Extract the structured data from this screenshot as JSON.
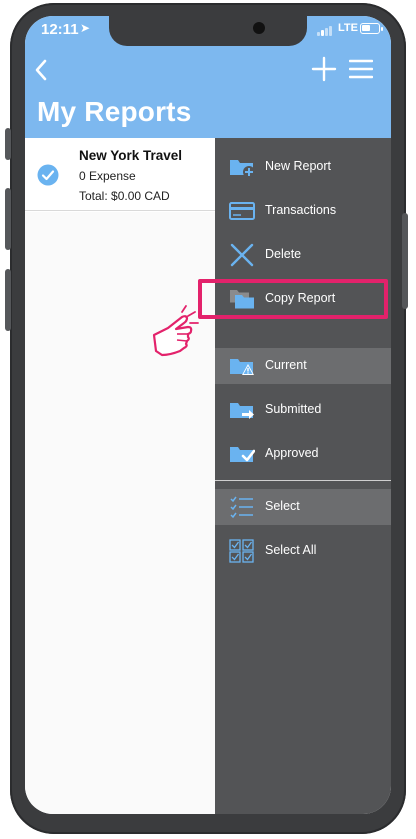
{
  "status_bar": {
    "time": "12:11",
    "network": "LTE"
  },
  "header": {
    "title": "My Reports"
  },
  "reports": [
    {
      "name": "New York Travel",
      "expense_count": "0 Expense",
      "total": "Total: $0.00 CAD",
      "selected": true
    }
  ],
  "menu": {
    "items": [
      {
        "label": "New Report",
        "icon": "new-report-icon"
      },
      {
        "label": "Transactions",
        "icon": "card-icon"
      },
      {
        "label": "Delete",
        "icon": "delete-x-icon"
      },
      {
        "label": "Copy Report",
        "icon": "copy-folder-icon"
      },
      {
        "label": "Current",
        "icon": "current-warning-folder-icon"
      },
      {
        "label": "Submitted",
        "icon": "submitted-arrow-folder-icon"
      },
      {
        "label": "Approved",
        "icon": "approved-check-folder-icon"
      },
      {
        "label": "Select",
        "icon": "checklist-icon"
      },
      {
        "label": "Select All",
        "icon": "select-all-checkbox-icon"
      }
    ]
  },
  "colors": {
    "header_blue": "#7db8ef",
    "menu_bg": "#535456",
    "menu_highlight": "#6c6d6f",
    "accent_blue": "#6ab3f0",
    "callout_pink": "#e3226b"
  }
}
